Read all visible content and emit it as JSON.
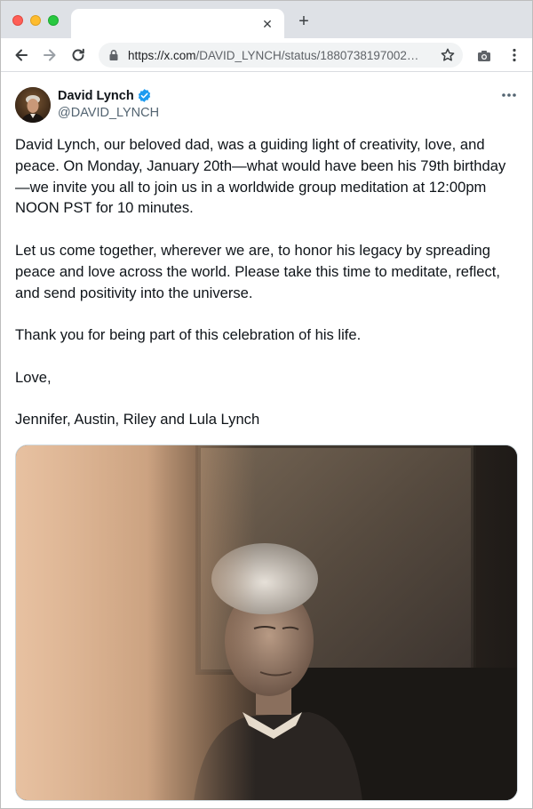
{
  "browser": {
    "tab_title": "",
    "url_host": "https://x.com",
    "url_path": "/DAVID_LYNCH/status/1880738197002…",
    "icons": [
      "back-icon",
      "forward-icon",
      "reload-icon",
      "lock-icon",
      "star-icon",
      "camera-icon",
      "kebab-icon",
      "close-icon",
      "plus-icon"
    ]
  },
  "tweet": {
    "author_name": "David Lynch",
    "author_handle": "@DAVID_LYNCH",
    "verified_color": "#1d9bf0",
    "paragraphs": [
      "David Lynch, our beloved dad, was a guiding light of creativity, love, and peace. On Monday, January 20th—what would have been his 79th birthday—we invite you all to join us in a worldwide group meditation at 12:00pm NOON PST for 10 minutes.",
      "Let us come together, wherever we are, to honor his legacy by spreading peace and love across the world. Please take this time to meditate, reflect, and send positivity into the universe.",
      "Thank you for being part of this celebration of his life.",
      "Love,",
      "Jennifer, Austin, Riley and Lula Lynch"
    ]
  }
}
